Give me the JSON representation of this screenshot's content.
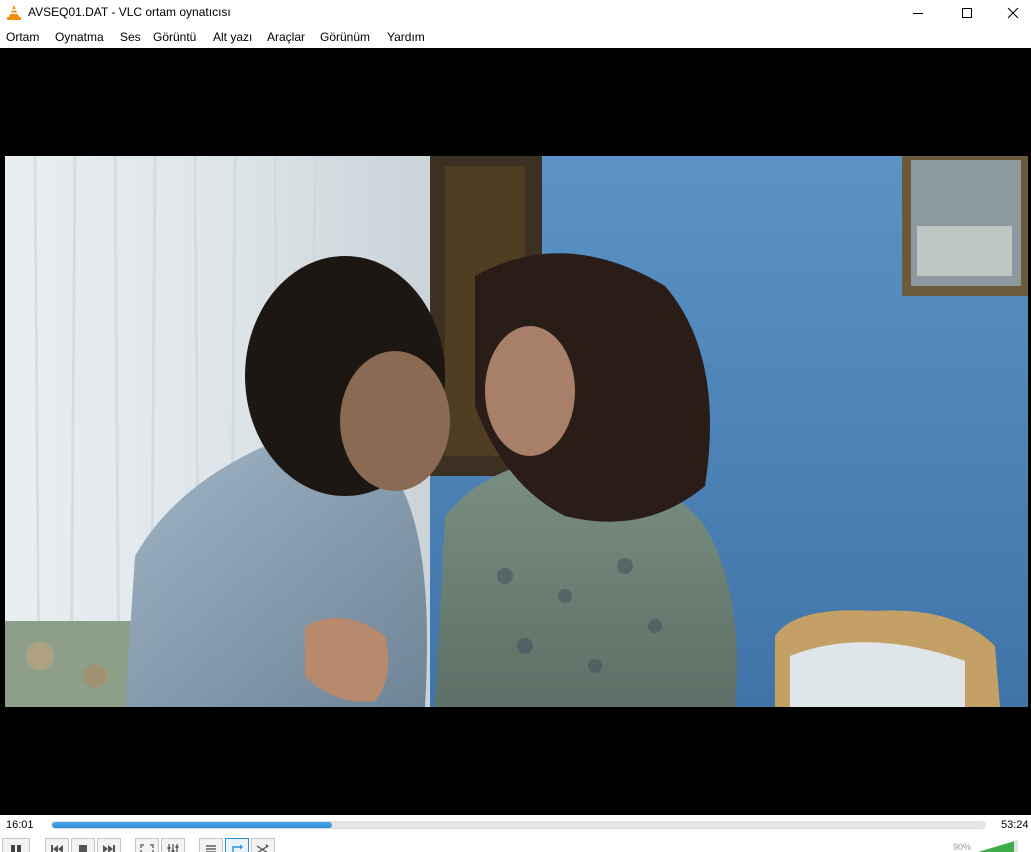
{
  "window": {
    "title": "AVSEQ01.DAT - VLC ortam oynatıcısı",
    "app_icon": "vlc-cone-icon",
    "controls": [
      "minimize-icon",
      "maximize-icon",
      "close-icon"
    ]
  },
  "menu": {
    "items": [
      "Ortam",
      "Oynatma",
      "Ses",
      "Görüntü",
      "Alt yazı",
      "Araçlar",
      "Görünüm",
      "Yardım"
    ]
  },
  "playback": {
    "elapsed": "16:01",
    "total": "53:24",
    "progress_fraction": 0.3
  },
  "volume": {
    "label": "90%",
    "level_percent": 90
  },
  "controls": {
    "buttons": [
      "pause-icon",
      "previous-icon",
      "stop-icon",
      "next-icon",
      "fullscreen-icon",
      "extended-settings-icon",
      "playlist-icon",
      "loop-icon",
      "shuffle-icon"
    ],
    "loop_active": true
  },
  "colors": {
    "accent": "#2c8fd9",
    "video_background": "#000000",
    "wall_blue": "#4f86b7"
  }
}
